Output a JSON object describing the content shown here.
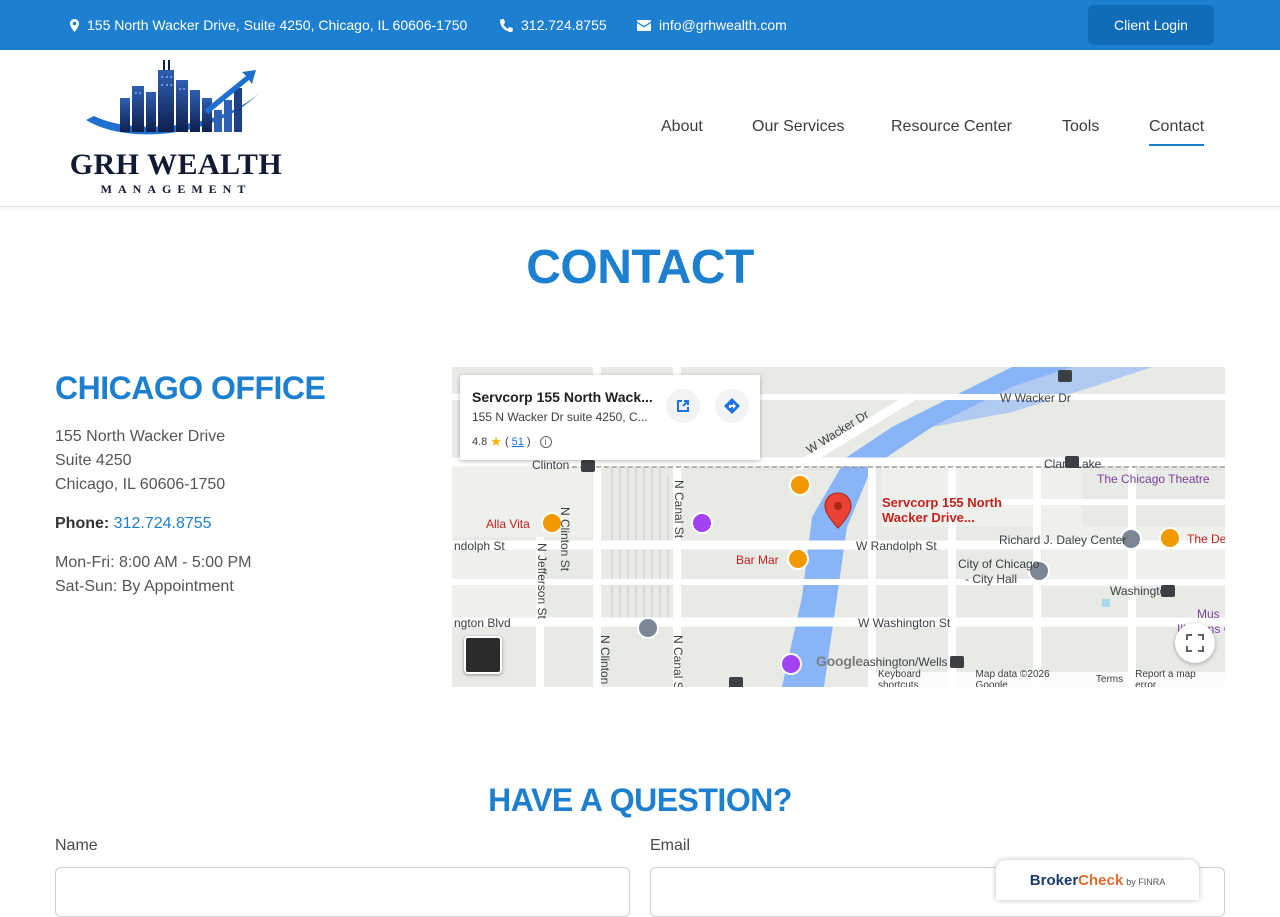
{
  "topbar": {
    "address": "155 North Wacker Drive, Suite 4250, Chicago, IL 60606-1750",
    "phone": "312.724.8755",
    "email": "info@grhwealth.com",
    "client_login": "Client Login"
  },
  "logo": {
    "name": "GRH WEALTH",
    "sub": "MANAGEMENT"
  },
  "nav": [
    {
      "label": "About"
    },
    {
      "label": "Our Services"
    },
    {
      "label": "Resource Center"
    },
    {
      "label": "Tools"
    },
    {
      "label": "Contact"
    }
  ],
  "page_title": "CONTACT",
  "office": {
    "title": "CHICAGO OFFICE",
    "street": "155 North Wacker Drive",
    "suite": "Suite 4250",
    "city": "Chicago, IL 60606-1750",
    "phone_label": "Phone:",
    "phone": "312.724.8755",
    "hours_weekday": "Mon-Fri: 8:00 AM - 5:00 PM",
    "hours_weekend": "Sat-Sun: By Appointment"
  },
  "map": {
    "card_title": "Servcorp 155 North Wack...",
    "card_address": "155 N Wacker Dr suite 4250, C...",
    "rating": "4.8",
    "review_count": "51",
    "marker_line1": "Servcorp 155 North",
    "marker_line2": "Wacker Drive...",
    "streets": {
      "w_wacker_dr_top": "W Wacker Dr",
      "w_wacker_dr_diag": "W Wacker Dr",
      "clark_lake": "Clark/Lake",
      "clinton": "Clinton",
      "n_clinton_st": "N Clinton St",
      "n_canal_st": "N Canal St",
      "n_jefferson_st": "N Jefferson St",
      "randolph_st_left": "ndolph St",
      "w_randolph_st": "W Randolph St",
      "w_washington_st": "W Washington St",
      "washington": "Washington",
      "washington_wells": "ashington/Wells",
      "ngton_blvd": "ngton Blvd",
      "n_clinton_bottom": "N Clinton",
      "n_canal_bottom": "N Canal St",
      "richard_daley": "Richard J. Daley Center",
      "city_hall_1": "City of Chicago",
      "city_hall_2": "- City Hall"
    },
    "pois": {
      "alla_vita": "Alla Vita",
      "bar_mar": "Bar Mar",
      "chicago_theatre": "The Chicago Theatre",
      "the_de": "The De",
      "mus": "Mus",
      "illusions": "Illusions C"
    },
    "google": "Google",
    "footer": {
      "shortcuts": "Keyboard shortcuts",
      "map_data": "Map data ©2026 Google",
      "terms": "Terms",
      "report": "Report a map error"
    },
    "colors": {
      "water": "#8ab4f8",
      "road": "#ffffff",
      "block": "#e8eae6",
      "marker": "#ea4335"
    }
  },
  "question": {
    "title": "HAVE A QUESTION?",
    "name_label": "Name",
    "email_label": "Email"
  },
  "brokercheck": {
    "broker": "Broker",
    "check": "Check",
    "by": "by FINRA"
  },
  "colors": {
    "primary": "#1d7fd0",
    "topbar": "#1d7fd0",
    "login_button": "#0f6cb8"
  }
}
